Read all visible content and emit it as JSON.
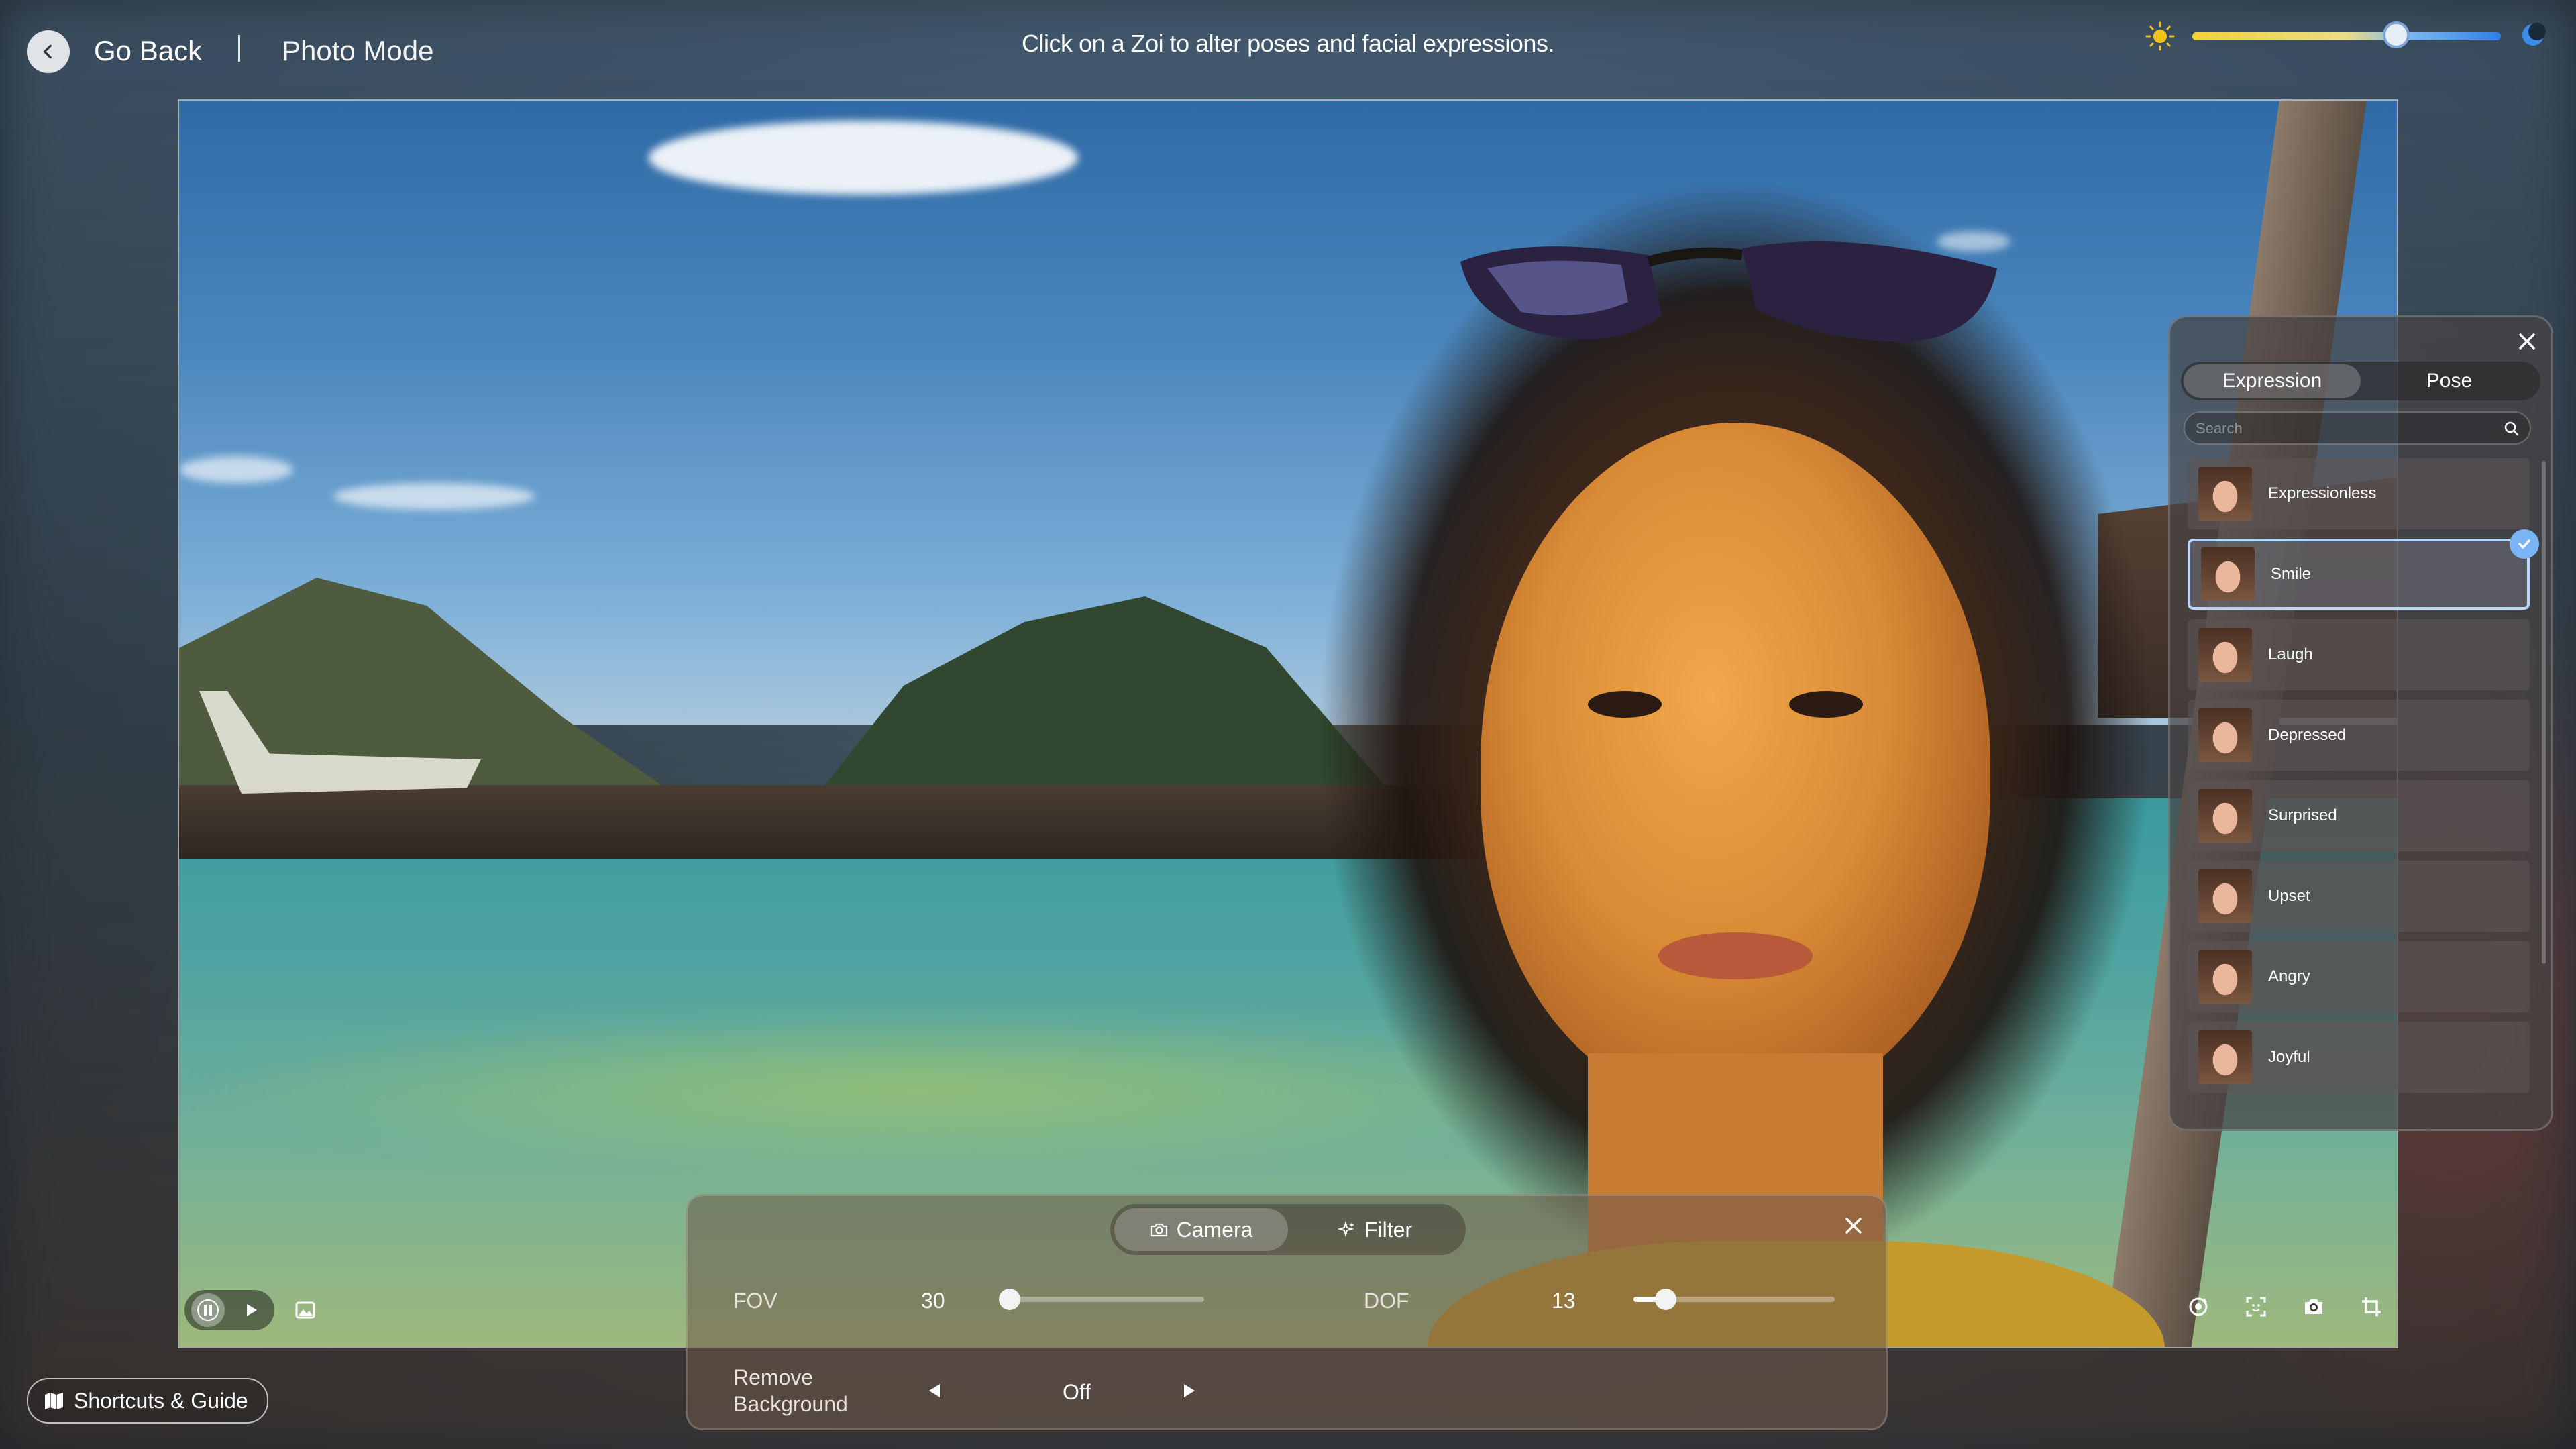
{
  "header": {
    "back_label": "Go Back",
    "mode_title": "Photo Mode",
    "hint": "Click on a Zoi to alter poses and facial expressions.",
    "time_of_day": 0.66
  },
  "camera_panel": {
    "tabs": [
      {
        "label": "Camera",
        "icon": "camera-icon",
        "active": true
      },
      {
        "label": "Filter",
        "icon": "sparkle-icon",
        "active": false
      }
    ],
    "fov": {
      "label": "FOV",
      "value": "30",
      "fraction": 0.0
    },
    "dof": {
      "label": "DOF",
      "value": "13",
      "fraction": 0.16
    },
    "remove_background": {
      "label_line1": "Remove",
      "label_line2": "Background",
      "value": "Off"
    }
  },
  "expression_panel": {
    "tabs": [
      {
        "label": "Expression",
        "active": true
      },
      {
        "label": "Pose",
        "active": false
      }
    ],
    "search_placeholder": "Search",
    "items": [
      {
        "label": "Expressionless",
        "selected": false
      },
      {
        "label": "Smile",
        "selected": true
      },
      {
        "label": "Laugh",
        "selected": false
      },
      {
        "label": "Depressed",
        "selected": false
      },
      {
        "label": "Surprised",
        "selected": false
      },
      {
        "label": "Upset",
        "selected": false
      },
      {
        "label": "Angry",
        "selected": false
      },
      {
        "label": "Joyful",
        "selected": false
      }
    ]
  },
  "footer": {
    "shortcuts_label": "Shortcuts & Guide"
  },
  "icons": {
    "back": "chevron-left-icon",
    "sun": "sun-icon",
    "moon": "moon-icon",
    "pause": "pause-icon",
    "play": "play-icon",
    "gallery": "gallery-icon",
    "rotate": "rotate-camera-icon",
    "focus": "focus-frame-icon",
    "capture": "camera-capture-icon",
    "crop": "crop-icon",
    "close": "close-icon",
    "search": "search-icon",
    "check": "check-icon",
    "map": "map-icon"
  },
  "colors": {
    "accent_blue": "#7ab4f2",
    "sun_yellow": "#f2c21b"
  }
}
